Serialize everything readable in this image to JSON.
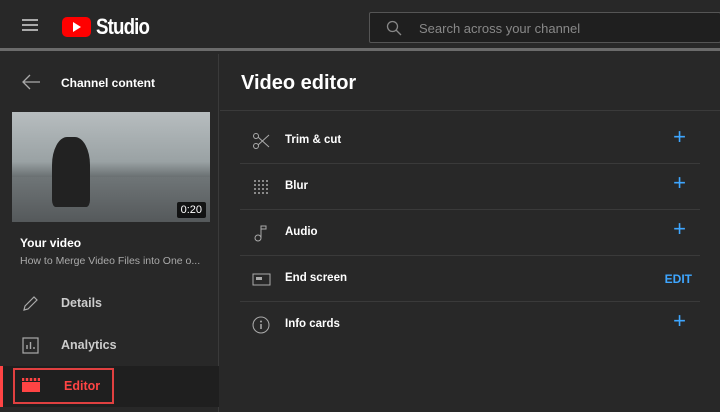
{
  "header": {
    "app_name": "Studio",
    "search_placeholder": "Search across your channel"
  },
  "sidebar": {
    "back_label": "Channel content",
    "video_label": "Your video",
    "video_title": "How to Merge Video Files into One o...",
    "duration": "0:20",
    "items": [
      {
        "label": "Details"
      },
      {
        "label": "Analytics"
      },
      {
        "label": "Editor",
        "active": true
      }
    ]
  },
  "main": {
    "title": "Video editor",
    "rows": [
      {
        "label": "Trim & cut",
        "action": "+"
      },
      {
        "label": "Blur",
        "action": "+"
      },
      {
        "label": "Audio",
        "action": "+"
      },
      {
        "label": "End screen",
        "action": "EDIT"
      },
      {
        "label": "Info cards",
        "action": "+"
      }
    ]
  },
  "colors": {
    "accent": "#3ea6ff",
    "active": "#ff4e45",
    "brand": "#ff0000"
  }
}
